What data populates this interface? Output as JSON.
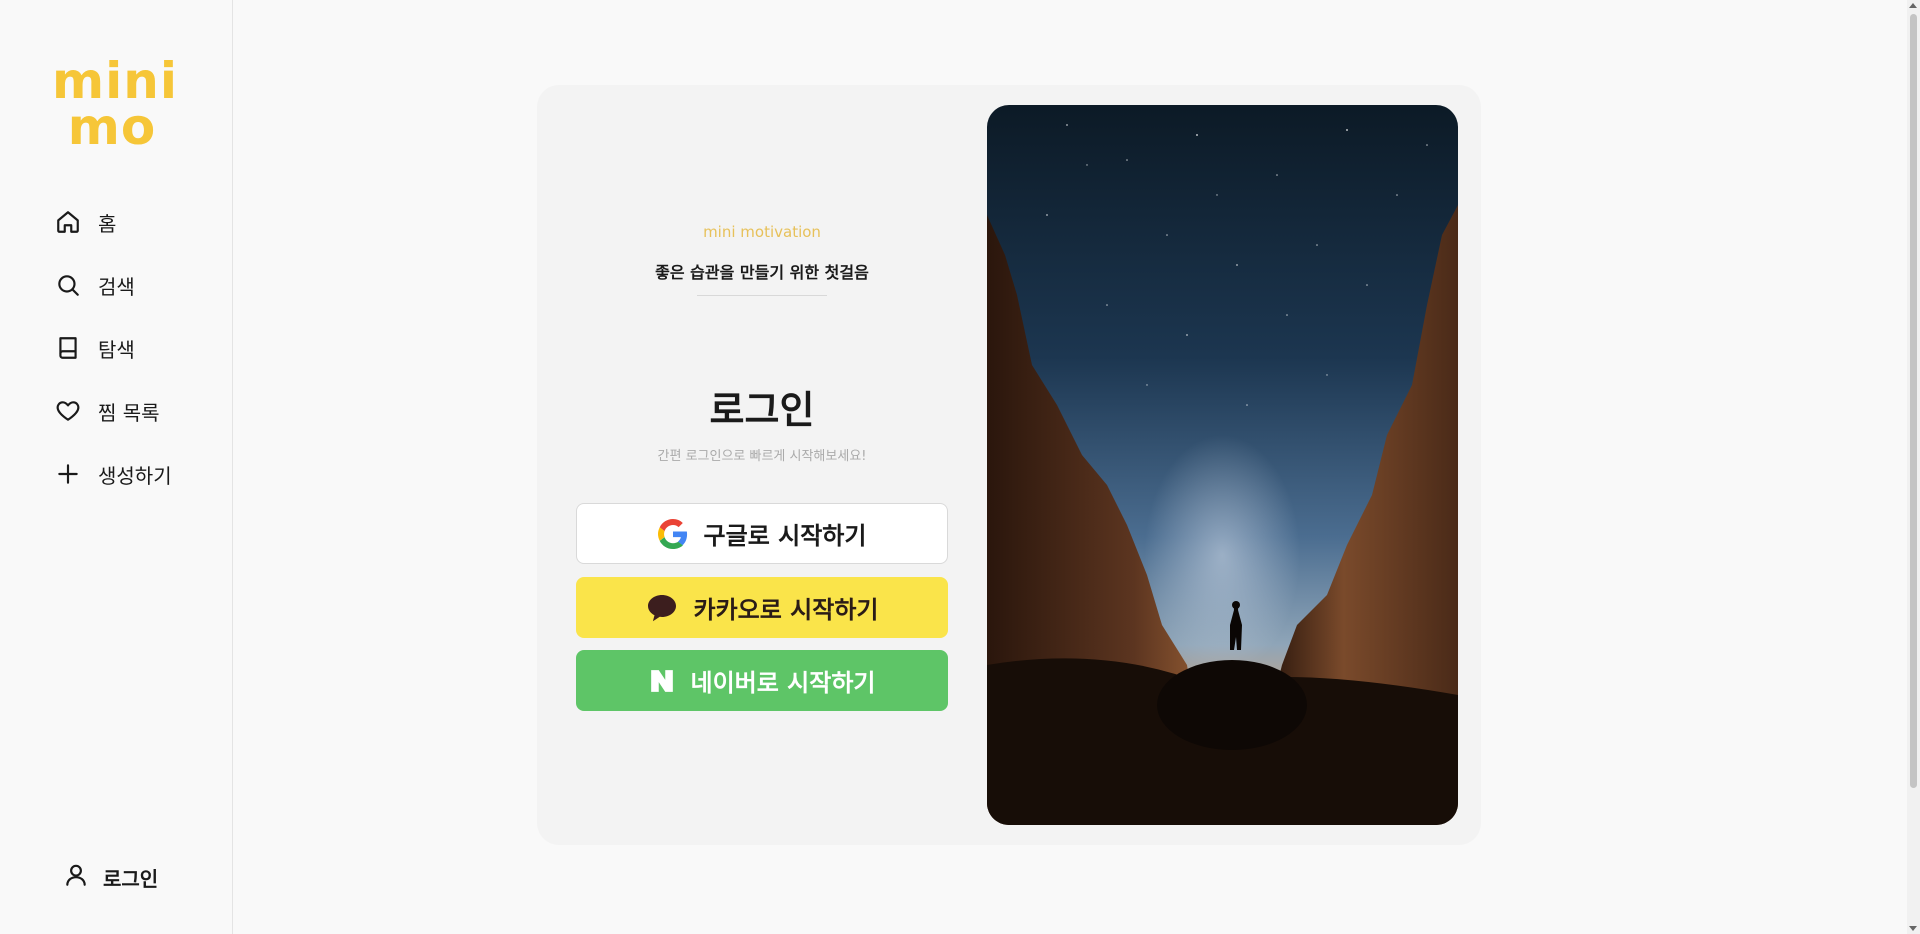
{
  "brand": {
    "logo_line1": "mini",
    "logo_line2": "mo",
    "color": "#f6c638"
  },
  "sidebar": {
    "items": [
      {
        "label": "홈",
        "icon": "home-icon"
      },
      {
        "label": "검색",
        "icon": "search-icon"
      },
      {
        "label": "탐색",
        "icon": "book-icon"
      },
      {
        "label": "찜 목록",
        "icon": "heart-icon"
      },
      {
        "label": "생성하기",
        "icon": "plus-icon"
      }
    ],
    "login_label": "로그인"
  },
  "login_card": {
    "tagline_en": "mini motivation",
    "tagline_ko": "좋은 습관을 만들기 위한 첫걸음",
    "title": "로그인",
    "subtitle": "간편 로그인으로 빠르게 시작해보세요!",
    "buttons": {
      "google": "구글로 시작하기",
      "kakao": "카카오로 시작하기",
      "naver": "네이버로 시작하기"
    },
    "colors": {
      "kakao": "#fae44a",
      "naver": "#5ec567",
      "accent": "#e7c15a"
    }
  }
}
